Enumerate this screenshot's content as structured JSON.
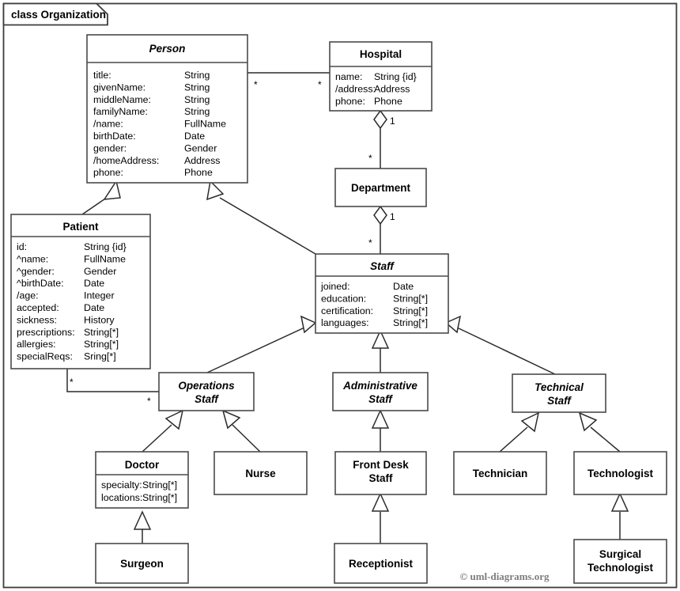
{
  "frame": {
    "label": "class Organization",
    "kind": "class-diagram-frame"
  },
  "copyright": "© uml-diagrams.org",
  "classes": {
    "person": {
      "name": "Person",
      "abstract": true,
      "attributes": [
        {
          "name": "title:",
          "type": "String"
        },
        {
          "name": "givenName:",
          "type": "String"
        },
        {
          "name": "middleName:",
          "type": "String"
        },
        {
          "name": "familyName:",
          "type": "String"
        },
        {
          "name": "/name:",
          "type": "FullName"
        },
        {
          "name": "birthDate:",
          "type": "Date"
        },
        {
          "name": "gender:",
          "type": "Gender"
        },
        {
          "name": "/homeAddress:",
          "type": "Address"
        },
        {
          "name": "phone:",
          "type": "Phone"
        }
      ]
    },
    "hospital": {
      "name": "Hospital",
      "abstract": false,
      "attributes": [
        {
          "name": "name:",
          "type": "String {id}"
        },
        {
          "name": "/address:",
          "type": "Address"
        },
        {
          "name": "phone:",
          "type": "Phone"
        }
      ]
    },
    "department": {
      "name": "Department",
      "abstract": false,
      "attributes": []
    },
    "patient": {
      "name": "Patient",
      "abstract": false,
      "attributes": [
        {
          "name": "id:",
          "type": "String {id}"
        },
        {
          "name": "^name:",
          "type": "FullName"
        },
        {
          "name": "^gender:",
          "type": "Gender"
        },
        {
          "name": "^birthDate:",
          "type": "Date"
        },
        {
          "name": "/age:",
          "type": "Integer"
        },
        {
          "name": "accepted:",
          "type": "Date"
        },
        {
          "name": "sickness:",
          "type": "History"
        },
        {
          "name": "prescriptions:",
          "type": "String[*]"
        },
        {
          "name": "allergies:",
          "type": "String[*]"
        },
        {
          "name": "specialReqs:",
          "type": "Sring[*]"
        }
      ]
    },
    "staff": {
      "name": "Staff",
      "abstract": true,
      "attributes": [
        {
          "name": "joined:",
          "type": "Date"
        },
        {
          "name": "education:",
          "type": "String[*]"
        },
        {
          "name": "certification:",
          "type": "String[*]"
        },
        {
          "name": "languages:",
          "type": "String[*]"
        }
      ]
    },
    "operations_staff": {
      "name": "Operations Staff",
      "name_lines": [
        "Operations",
        "Staff"
      ],
      "abstract": true,
      "attributes": []
    },
    "administrative_staff": {
      "name": "Administrative Staff",
      "name_lines": [
        "Administrative",
        "Staff"
      ],
      "abstract": true,
      "attributes": []
    },
    "technical_staff": {
      "name": "Technical Staff",
      "name_lines": [
        "Technical",
        "Staff"
      ],
      "abstract": true,
      "attributes": []
    },
    "doctor": {
      "name": "Doctor",
      "abstract": false,
      "attributes": [
        {
          "name": "specialty:",
          "type": "String[*]"
        },
        {
          "name": "locations:",
          "type": "String[*]"
        }
      ]
    },
    "nurse": {
      "name": "Nurse",
      "abstract": false,
      "attributes": []
    },
    "front_desk_staff": {
      "name": "Front Desk Staff",
      "name_lines": [
        "Front Desk",
        "Staff"
      ],
      "abstract": false,
      "attributes": []
    },
    "technician": {
      "name": "Technician",
      "abstract": false,
      "attributes": []
    },
    "technologist": {
      "name": "Technologist",
      "abstract": false,
      "attributes": []
    },
    "surgeon": {
      "name": "Surgeon",
      "abstract": false,
      "attributes": []
    },
    "receptionist": {
      "name": "Receptionist",
      "abstract": false,
      "attributes": []
    },
    "surgical_technologist": {
      "name": "Surgical Technologist",
      "name_lines": [
        "Surgical",
        "Technologist"
      ],
      "abstract": false,
      "attributes": []
    }
  },
  "relationships": [
    {
      "id": "person-hospital",
      "kind": "association",
      "from": "person",
      "to": "hospital",
      "from_multiplicity": "*",
      "to_multiplicity": "*"
    },
    {
      "id": "hospital-department",
      "kind": "aggregation",
      "whole": "hospital",
      "part": "department",
      "whole_multiplicity": "1",
      "part_multiplicity": "*"
    },
    {
      "id": "department-staff",
      "kind": "aggregation",
      "whole": "department",
      "part": "staff",
      "whole_multiplicity": "1",
      "part_multiplicity": "*"
    },
    {
      "id": "patient-operations-staff",
      "kind": "association",
      "from": "patient",
      "to": "operations_staff",
      "from_multiplicity": "*",
      "to_multiplicity": "*"
    },
    {
      "id": "patient-person",
      "kind": "generalization",
      "sub": "patient",
      "super": "person"
    },
    {
      "id": "staff-person",
      "kind": "generalization",
      "sub": "staff",
      "super": "person"
    },
    {
      "id": "operations-staff",
      "kind": "generalization",
      "sub": "operations_staff",
      "super": "staff"
    },
    {
      "id": "administrative-staff",
      "kind": "generalization",
      "sub": "administrative_staff",
      "super": "staff"
    },
    {
      "id": "technical-staff",
      "kind": "generalization",
      "sub": "technical_staff",
      "super": "staff"
    },
    {
      "id": "doctor-operations",
      "kind": "generalization",
      "sub": "doctor",
      "super": "operations_staff"
    },
    {
      "id": "nurse-operations",
      "kind": "generalization",
      "sub": "nurse",
      "super": "operations_staff"
    },
    {
      "id": "frontdesk-administrative",
      "kind": "generalization",
      "sub": "front_desk_staff",
      "super": "administrative_staff"
    },
    {
      "id": "technician-technical",
      "kind": "generalization",
      "sub": "technician",
      "super": "technical_staff"
    },
    {
      "id": "technologist-technical",
      "kind": "generalization",
      "sub": "technologist",
      "super": "technical_staff"
    },
    {
      "id": "surgeon-doctor",
      "kind": "generalization",
      "sub": "surgeon",
      "super": "doctor"
    },
    {
      "id": "receptionist-frontdesk",
      "kind": "generalization",
      "sub": "receptionist",
      "super": "front_desk_staff"
    },
    {
      "id": "surgtech-technologist",
      "kind": "generalization",
      "sub": "surgical_technologist",
      "super": "technologist"
    }
  ],
  "multiplicity_labels": {
    "person_to_hospital": "*",
    "hospital_to_person": "*",
    "hospital_whole": "1",
    "department_part": "*",
    "department_whole": "1",
    "staff_part": "*",
    "patient_end": "*",
    "operations_end": "*"
  },
  "colors": {
    "box_stroke": "#4a4a4a",
    "line": "#2b2b2b",
    "frame_stroke": "#3c3c3c",
    "background": "#ffffff",
    "copyright_text": "#7d7d7d"
  }
}
